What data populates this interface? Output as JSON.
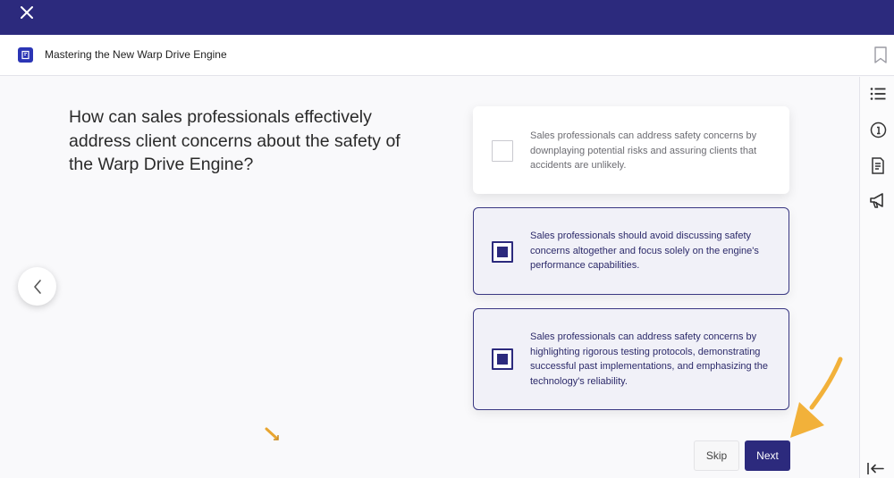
{
  "header": {
    "close_icon": "close-icon"
  },
  "course": {
    "title": "Mastering the New Warp Drive Engine",
    "icon": "book-icon",
    "bookmark_icon": "bookmark-icon"
  },
  "question": {
    "text": "How can sales professionals effectively address client concerns about the safety of the Warp Drive Engine?"
  },
  "options": [
    {
      "text": "Sales professionals can address safety concerns by downplaying potential risks and assuring clients that accidents are unlikely.",
      "selected": false
    },
    {
      "text": "Sales professionals should avoid discussing safety concerns altogether and focus solely on the engine's performance capabilities.",
      "selected": true
    },
    {
      "text": "Sales professionals can address safety concerns by highlighting rigorous testing protocols, demonstrating successful past implementations, and emphasizing the technology's reliability.",
      "selected": true
    }
  ],
  "navigation": {
    "prev_icon": "chevron-left-icon",
    "skip_label": "Skip",
    "next_label": "Next"
  },
  "sidebar": {
    "icons": [
      "list-icon",
      "info-icon",
      "document-icon",
      "megaphone-icon"
    ],
    "collapse_icon": "collapse-left-icon"
  },
  "colors": {
    "brand": "#2c2a7d",
    "accent_arrow": "#f2b13a"
  }
}
